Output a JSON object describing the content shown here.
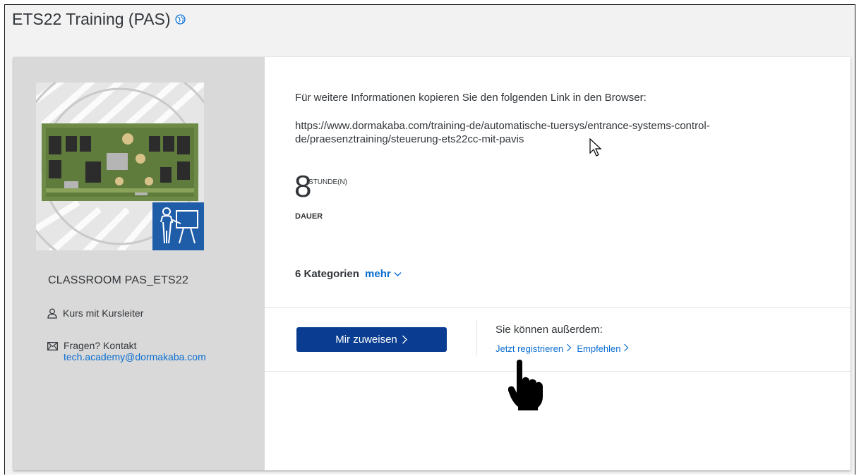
{
  "header": {
    "title": "ETS22 Training (PAS)",
    "globe_icon": "globe-icon"
  },
  "left": {
    "course_id": "CLASSROOM PAS_ETS22",
    "type_label": "Kurs mit Kursleiter",
    "contact_label": "Fragen? Kontakt",
    "contact_email": "tech.academy@dormakaba.com"
  },
  "main": {
    "info_text": "Für weitere Informationen kopieren Sie den folgenden Link in den Browser:",
    "link_line1": "https://www.dormakaba.com/training-de/automatische-tuersys/entrance-systems-control-",
    "link_line2": "de/praesenztraining/steuerung-ets22cc-mit-pavis",
    "duration_value": "8",
    "duration_unit": "STUNDE(N)",
    "duration_label": "DAUER",
    "categories_label": "6 Kategorien",
    "more_label": "mehr"
  },
  "actions": {
    "assign_label": "Mir zuweisen",
    "also_label": "Sie können außerdem:",
    "register_label": "Jetzt registrieren",
    "recommend_label": "Empfehlen"
  },
  "colors": {
    "primary_button": "#0a3d91",
    "link": "#0a6ed1",
    "sidebar": "#d9d9d9",
    "badge": "#1f5da8"
  }
}
